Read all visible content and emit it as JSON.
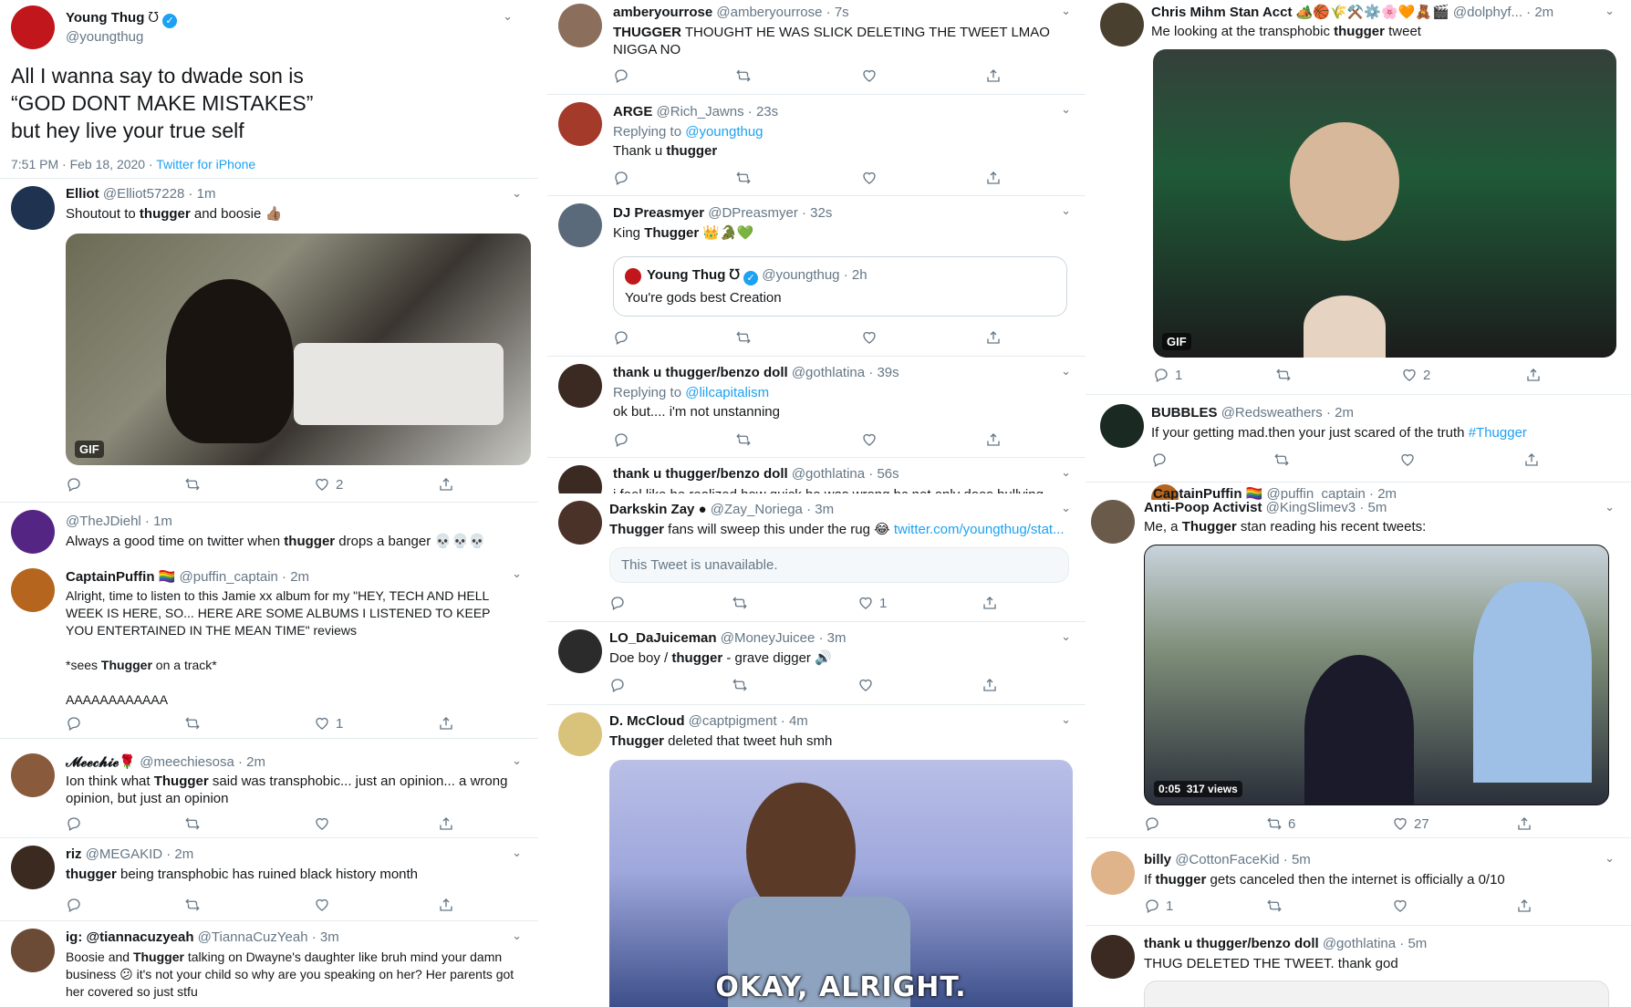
{
  "main": {
    "name": "Young Thug",
    "name_glyph": "ᘮ",
    "handle": "@youngthug",
    "text": "All I wanna say to dwade son is\n“GOD DONT MAKE MISTAKES”\nbut hey live your true self",
    "timestamp": "7:51 PM · Feb 18, 2020 · ",
    "client": "Twitter for iPhone"
  },
  "col1": [
    {
      "id": "elliot",
      "name": "Elliot",
      "handle": "@Elliot57228 · 1m",
      "text_pre": "Shoutout to ",
      "bold": "thugger",
      "text_post": " and boosie 👍🏽",
      "gif_label": "GIF",
      "likes": "2"
    },
    {
      "id": "thejdiehl",
      "name": "",
      "handle": "@TheJDiehl · 1m",
      "text_pre": "Always a good time on twitter when ",
      "bold": "thugger",
      "text_post": " drops a banger 💀💀💀"
    },
    {
      "id": "captainpuffin",
      "name": "CaptainPuffin 🏳️‍🌈",
      "handle": "@puffin_captain · 2m",
      "text_pre": "Alright, time to listen to this Jamie xx album for my \"HEY, TECH AND HELL WEEK IS HERE, SO... HERE ARE SOME ALBUMS I LISTENED TO KEEP YOU ENTERTAINED IN THE MEAN TIME\" reviews\n\n*sees ",
      "bold": "Thugger",
      "text_post": " on a track*\n\nAAAAAAAAAAAA",
      "likes": "1"
    },
    {
      "id": "meechie",
      "name": "𝓜𝓮𝓮𝓬𝓱𝓲𝓮🌹",
      "handle": "@meechiesosa · 2m",
      "text_pre": "Ion think what ",
      "bold": "Thugger",
      "text_post": " said was transphobic... just an opinion... a wrong opinion, but just an opinion"
    },
    {
      "id": "riz",
      "name": "riz",
      "handle": "@MEGAKID · 2m",
      "text_pre": "",
      "bold": "thugger",
      "text_post": " being transphobic has ruined black history month"
    },
    {
      "id": "tianna",
      "name": "ig: @tiannacuzyeah",
      "handle": "@TiannaCuzYeah · 3m",
      "text_pre": "Boosie and ",
      "bold": "Thugger",
      "text_post": " talking on Dwayne's daughter like bruh mind your damn business 😕 it's not your child so why are you speaking on her? Her parents got her covered so just stfu"
    }
  ],
  "col2": [
    {
      "id": "amberyourrose",
      "name": "amberyourrose",
      "handle": "@amberyourrose · 7s",
      "text_pre": "",
      "bold": "THUGGER",
      "text_post": " THOUGHT HE WAS SLICK DELETING THE TWEET LMAO NIGGA NO"
    },
    {
      "id": "arge",
      "name": "ARGE",
      "handle": "@Rich_Jawns · 23s",
      "reply_label": "Replying to ",
      "reply_to": "@youngthug",
      "text_pre": "Thank u ",
      "bold": "thugger",
      "text_post": ""
    },
    {
      "id": "djpreasmyer",
      "name": "DJ Preasmyer",
      "handle": "@DPreasmyer · 32s",
      "text_pre": "King ",
      "bold": "Thugger",
      "text_post": " 👑🐊💚",
      "quote_name": "Young Thug ᘮ",
      "quote_handle": "@youngthug · 2h",
      "quote_text": "You're gods best Creation"
    },
    {
      "id": "gothlatina1",
      "name": "thank u thugger/benzo doll",
      "handle": "@gothlatina · 39s",
      "reply_label": "Replying to ",
      "reply_to": "@lilcapitalism",
      "text_pre": "ok but.... i'm not unstanning",
      "bold": "",
      "text_post": ""
    },
    {
      "id": "gothlatina2",
      "name": "thank u thugger/benzo doll",
      "handle": "@gothlatina · 56s",
      "text_pre": "i feel like he realized how quick he was wrong bc not only does bullying",
      "bold": "",
      "text_post": ""
    },
    {
      "id": "darkskinzay",
      "name": "Darkskin Zay ●",
      "handle": "@Zay_Noriega · 3m",
      "text_pre": "",
      "bold": "Thugger",
      "text_post": " fans will sweep this under the rug 😂 ",
      "link": "twitter.com/youngthug/stat...",
      "unavailable": "This Tweet is unavailable.",
      "likes": "1"
    },
    {
      "id": "lodajuiceman",
      "name": "LO_DaJuiceman",
      "handle": "@MoneyJuicee · 3m",
      "text_pre": "Doe boy / ",
      "bold": "thugger",
      "text_post": " - grave digger 🔊"
    },
    {
      "id": "dmccloud",
      "name": "D. McCloud",
      "handle": "@captpigment · 4m",
      "text_pre": "",
      "bold": "Thugger",
      "text_post": " deleted that tweet huh smh",
      "caption": "OKAY, ALRIGHT."
    }
  ],
  "col3": [
    {
      "id": "chrismihm",
      "name": "Chris Mihm Stan Acct 🏕️🏀🌾⚒️⚙️🌸🧡🧸🎬",
      "handle": "@dolphyf... · 2m",
      "text_pre": "Me looking at the transphobic ",
      "bold": "thugger",
      "text_post": " tweet",
      "gif_label": "GIF",
      "replies": "1",
      "likes": "2"
    },
    {
      "id": "bubbles",
      "name": "BUBBLES",
      "handle": "@Redsweathers · 2m",
      "text_pre": "If your getting mad.then your just scared of the truth ",
      "bold": "",
      "text_post": "",
      "hashtag": "#Thugger"
    },
    {
      "id": "captainpuffin2",
      "name": "CaptainPuffin 🏳️‍🌈",
      "handle": "@puffin_captain · 2m"
    },
    {
      "id": "antipoop",
      "name": "Anti-Poop Activist",
      "handle": "@KingSlimev3 · 5m",
      "text_pre": "Me, a ",
      "bold": "Thugger",
      "text_post": " stan reading his recent tweets:",
      "video_time": "0:05",
      "video_views": "317 views",
      "retweets": "6",
      "likes": "27"
    },
    {
      "id": "billy",
      "name": "billy",
      "handle": "@CottonFaceKid · 5m",
      "text_pre": "If ",
      "bold": "thugger",
      "text_post": " gets canceled then the internet is officially a 0/10",
      "replies": "1"
    },
    {
      "id": "gothlatina3",
      "name": "thank u thugger/benzo doll",
      "handle": "@gothlatina · 5m",
      "text_pre": "THUG DELETED THE TWEET. thank god",
      "bold": "",
      "text_post": ""
    }
  ],
  "colors": {
    "accent": "#1da1f2",
    "muted": "#657786",
    "border": "#e6ecf0"
  }
}
